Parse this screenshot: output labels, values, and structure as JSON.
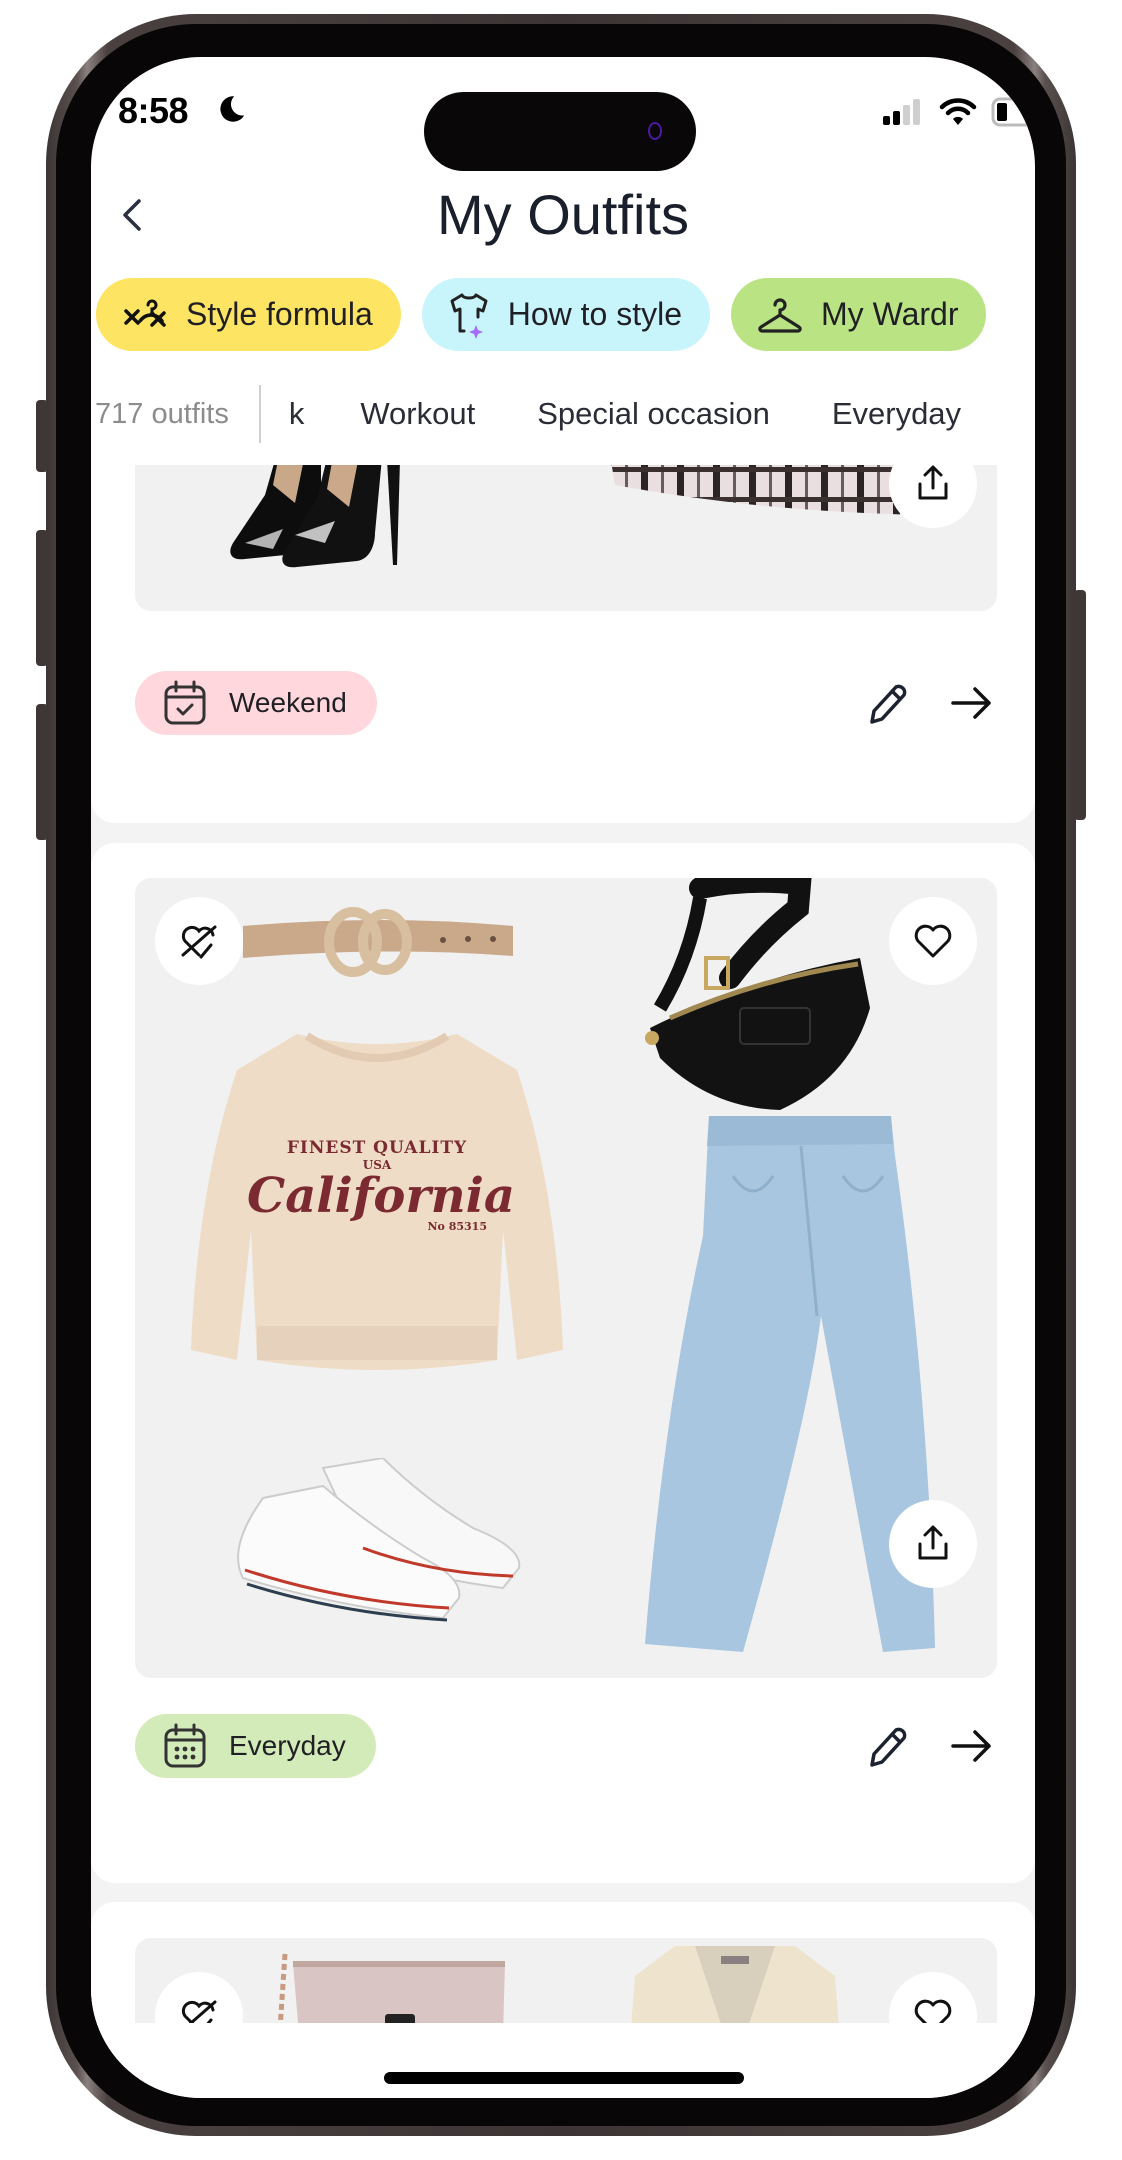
{
  "status_bar": {
    "time": "8:58",
    "focus_icon": "moon-icon",
    "icons": [
      "cellular-signal-icon",
      "wifi-icon",
      "battery-icon"
    ]
  },
  "header": {
    "title": "My Outfits",
    "back_icon": "chevron-left-icon"
  },
  "quick_actions": [
    {
      "label": "Style formula",
      "icon": "style-formula-icon",
      "color": "#fde462"
    },
    {
      "label": "How to style",
      "icon": "tshirt-sparkle-icon",
      "color": "#c8f4fb"
    },
    {
      "label": "My Wardr",
      "icon": "hanger-icon",
      "color": "#bae383"
    }
  ],
  "filter_tabs": {
    "count_label": "717 outfits",
    "tabs": [
      "k",
      "Workout",
      "Special occasion",
      "Everyday"
    ]
  },
  "outfits": [
    {
      "occasion": "Weekend",
      "occasion_icon": "calendar-check-icon",
      "occasion_color": "#ffd7dd",
      "items": [
        "black patent pumps",
        "plaid skirt"
      ],
      "actions": {
        "share": "share-icon",
        "edit": "pencil-icon",
        "open": "arrow-right-icon"
      }
    },
    {
      "occasion": "Everyday",
      "occasion_icon": "calendar-dots-icon",
      "occasion_color": "#d3ebb8",
      "items": [
        "tan belt",
        "California sweatshirt",
        "white sneakers",
        "black belt bag",
        "light wash wide-leg jeans"
      ],
      "sweatshirt_print": {
        "line1": "FINEST QUALITY",
        "badge": "USA",
        "main": "California",
        "number": "No 85315"
      },
      "actions": {
        "dislike": "heart-off-icon",
        "like": "heart-icon",
        "share": "share-icon",
        "edit": "pencil-icon",
        "open": "arrow-right-icon"
      }
    },
    {
      "items": [
        "quilted pink crossbody bag",
        "cream cable-knit cardigan"
      ],
      "actions": {
        "dislike": "heart-off-icon",
        "like": "heart-icon"
      }
    }
  ]
}
